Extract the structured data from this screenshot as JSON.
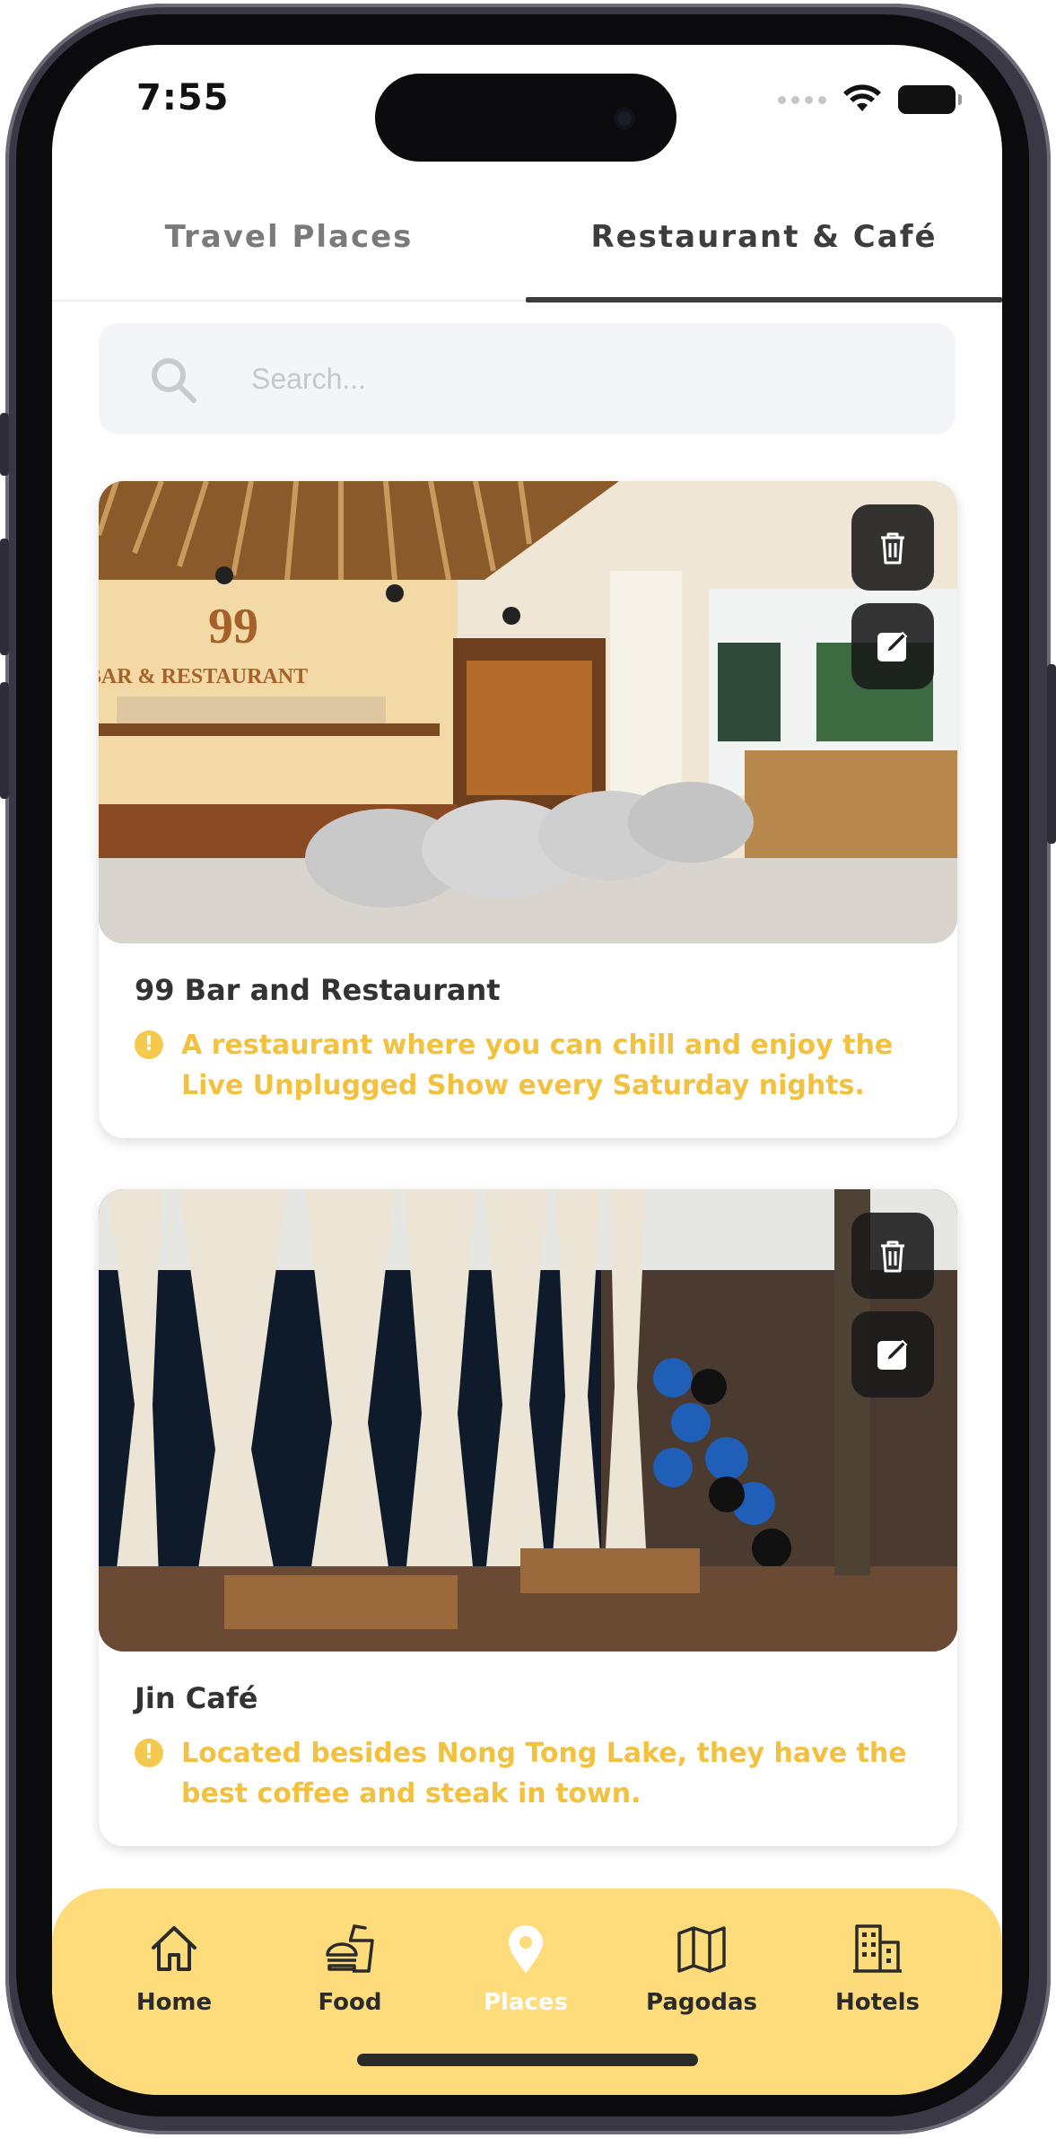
{
  "status_bar": {
    "time": "7:55"
  },
  "tabs": [
    {
      "label": "Travel Places",
      "active": false
    },
    {
      "label": "Restaurant & Café",
      "active": true
    }
  ],
  "search": {
    "placeholder": "Search...",
    "value": ""
  },
  "cards": [
    {
      "title": "99 Bar and Restaurant",
      "description": "A restaurant where you can chill and enjoy the Live Unplugged Show every Saturday nights.",
      "sign_text": "99",
      "sign_subtext": "BAR & RESTAURANT"
    },
    {
      "title": "Jin Café",
      "description": "Located besides Nong Tong Lake, they have the best coffee and steak in town."
    }
  ],
  "bottom_nav": [
    {
      "label": "Home",
      "icon": "home-icon",
      "active": false
    },
    {
      "label": "Food",
      "icon": "food-icon",
      "active": false
    },
    {
      "label": "Places",
      "icon": "location-pin-icon",
      "active": true
    },
    {
      "label": "Pagodas",
      "icon": "map-icon",
      "active": false
    },
    {
      "label": "Hotels",
      "icon": "building-icon",
      "active": false
    }
  ],
  "colors": {
    "accent": "#fedc7c",
    "warning_text": "#f2c140",
    "tab_active": "#3d3d3d",
    "tab_inactive": "#7a7a7a"
  }
}
